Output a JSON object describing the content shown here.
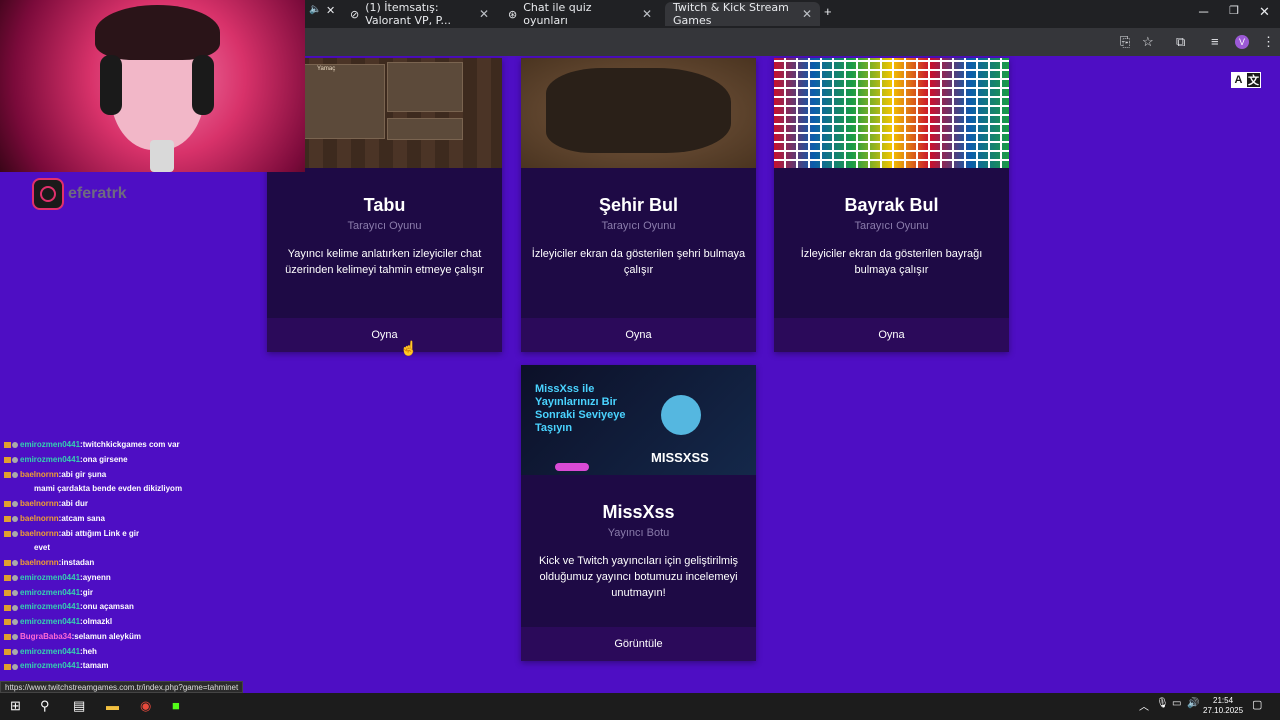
{
  "browser": {
    "tabs": [
      {
        "label": "(1) İtemsatış: Valorant VP, P...",
        "icon": "item-site-icon"
      },
      {
        "label": "Chat ile quiz oyunları",
        "icon": "openai-icon"
      },
      {
        "label": "Twitch & Kick Stream Games",
        "icon": "twitch-icon",
        "active": true
      }
    ],
    "new_tab": "+",
    "profile_initial": "V"
  },
  "overlay": {
    "instagram_user": "eferatrk"
  },
  "translate": {
    "a": "A",
    "b": "文"
  },
  "cards": [
    {
      "title": "Tabu",
      "subtitle": "Tarayıcı Oyunu",
      "description": "Yayıncı kelime anlatırken izleyiciler chat üzerinden kelimeyi tahmin etmeye çalışır",
      "button": "Oyna",
      "thumb_text": "Yamaç"
    },
    {
      "title": "Şehir Bul",
      "subtitle": "Tarayıcı Oyunu",
      "description": "İzleyiciler ekran da gösterilen şehri bulmaya çalışır",
      "button": "Oyna"
    },
    {
      "title": "Bayrak Bul",
      "subtitle": "Tarayıcı Oyunu",
      "description": "İzleyiciler ekran da gösterilen bayrağı bulmaya çalışır",
      "button": "Oyna"
    },
    {
      "title": "MissXss",
      "subtitle": "Yayıncı Botu",
      "description": "Kick ve Twitch yayıncıları için geliştirilmiş olduğumuz yayıncı botumuzu incelemeyi unutmayın!",
      "button": "Görüntüle",
      "thumb_heading": "MissXss ile Yayınlarınızı Bir Sonraki Seviyeye Taşıyın",
      "thumb_brand": "MISSXSS"
    }
  ],
  "chat": [
    {
      "user": "emirozmen0441",
      "msg": "twitchkickgames com var",
      "color": "#35d1b0"
    },
    {
      "user": "emirozmen0441",
      "msg": "ona girsene",
      "color": "#35d1b0"
    },
    {
      "user": "baelnornn",
      "msg": "abi gir şuna",
      "color": "#f0a030"
    },
    {
      "user": "",
      "msg": "mami çardakta bende evden dikizliyom",
      "color": "#d02020"
    },
    {
      "user": "baelnornn",
      "msg": "abi dur",
      "color": "#f0a030"
    },
    {
      "user": "baelnornn",
      "msg": "atcam sana",
      "color": "#f0a030"
    },
    {
      "user": "baelnornn",
      "msg": "abi attığım Link e gir",
      "color": "#f0a030"
    },
    {
      "user": "",
      "msg": "evet",
      "color": "#d02020"
    },
    {
      "user": "baelnornn",
      "msg": "instadan",
      "color": "#f0a030"
    },
    {
      "user": "emirozmen0441",
      "msg": "aynenn",
      "color": "#35d1b0"
    },
    {
      "user": "emirozmen0441",
      "msg": "gir",
      "color": "#35d1b0"
    },
    {
      "user": "emirozmen0441",
      "msg": "onu açamsan",
      "color": "#35d1b0"
    },
    {
      "user": "emirozmen0441",
      "msg": "olmazkl",
      "color": "#35d1b0"
    },
    {
      "user": "BugraBaba34",
      "msg": "selamun aleyküm",
      "color": "#ff6ad5"
    },
    {
      "user": "emirozmen0441",
      "msg": "heh",
      "color": "#35d1b0"
    },
    {
      "user": "emirozmen0441",
      "msg": "tamam",
      "color": "#35d1b0"
    }
  ],
  "status_url": "https://www.twitchstreamgames.com.tr/index.php?game=tahminet",
  "taskbar": {
    "time": "21:54",
    "date": "27.10.2025"
  }
}
